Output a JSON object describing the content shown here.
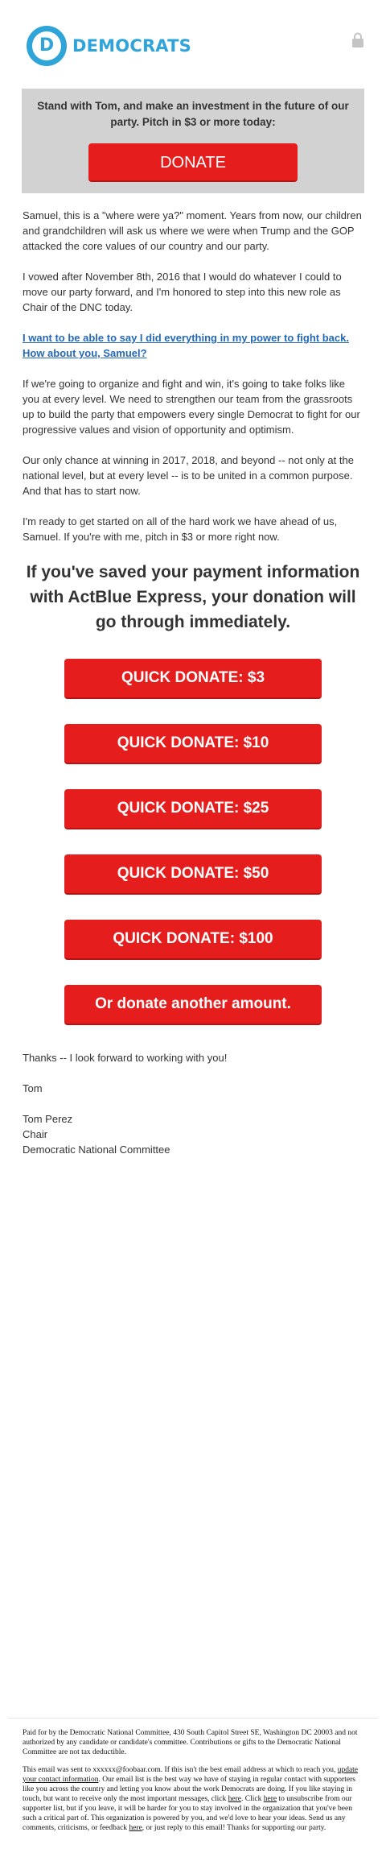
{
  "header": {
    "logo_letter": "D",
    "logo_text": "DEMOCRATS",
    "lock_icon": "lock-icon"
  },
  "banner": {
    "text": "Stand with Tom, and make an investment in the future of our party. Pitch in $3 or more today:",
    "donate_label": "DONATE"
  },
  "body": {
    "p1": "Samuel, this is a \"where were ya?\" moment. Years from now, our children and grandchildren will ask us where we were when Trump and the GOP attacked the core values of our country and our party.",
    "p2": "I vowed after November 8th, 2016 that I would do whatever I could to move our party forward, and I'm honored to step into this new role as Chair of the DNC today.",
    "link": "I want to be able to say I did everything in my power to fight back. How about you, Samuel?",
    "p3": "If we're going to organize and fight and win, it's going to take folks like you at every level. We need to strengthen our team from the grassroots up to build the party that empowers every single Democrat to fight for our progressive values and vision of opportunity and optimism.",
    "p4": "Our only chance at winning in 2017, 2018, and beyond -- not only at the national level, but at every level -- is to be united in a common purpose. And that has to start now.",
    "p5": "I'm ready to get started on all of the hard work we have ahead of us, Samuel. If you're with me, pitch in $3 or more right now."
  },
  "headline": "If you've saved your payment information with ActBlue Express, your donation will go through immediately.",
  "quick_donate": [
    "QUICK DONATE: $3",
    "QUICK DONATE: $10",
    "QUICK DONATE: $25",
    "QUICK DONATE: $50",
    "QUICK DONATE: $100",
    "Or donate another amount."
  ],
  "closing": {
    "thanks": "Thanks -- I look forward to working with you!",
    "sign": "Tom",
    "name": "Tom Perez",
    "title": "Chair",
    "org": "Democratic National Committee"
  },
  "footer": {
    "paid_for": "Paid for by the Democratic National Committee, 430 South Capitol Street SE, Washington DC 20003 and not authorized by any candidate or candidate's committee. Contributions or gifts to the Democratic National Committee are not tax deductible.",
    "sent_to_1": "This email was sent to xxxxxx@foobaar.com. If this isn't the best email address at which to reach you, ",
    "update_link": "update your contact information",
    "sent_to_2": ". Our email list is the best way we have of staying in regular contact with supporters like you across the country and letting you know about the work Democrats are doing. If you like staying in touch, but want to receive only the most important messages, click ",
    "here1": "here",
    "sent_to_3": ". Click ",
    "here2": "here",
    "sent_to_4": " to unsubscribe from our supporter list, but if you leave, it will be harder for you to stay involved in the organization that you've been such a critical part of. This organization is powered by you, and we'd love to hear your ideas. Send us any comments, criticisms, or feedback ",
    "here3": "here",
    "sent_to_5": ", or just reply to this email! Thanks for supporting our party."
  },
  "colors": {
    "brand_blue": "#2fa4d9",
    "button_red": "#e51d1d",
    "banner_gray": "#d2d2d2",
    "link_blue": "#2469b8"
  }
}
